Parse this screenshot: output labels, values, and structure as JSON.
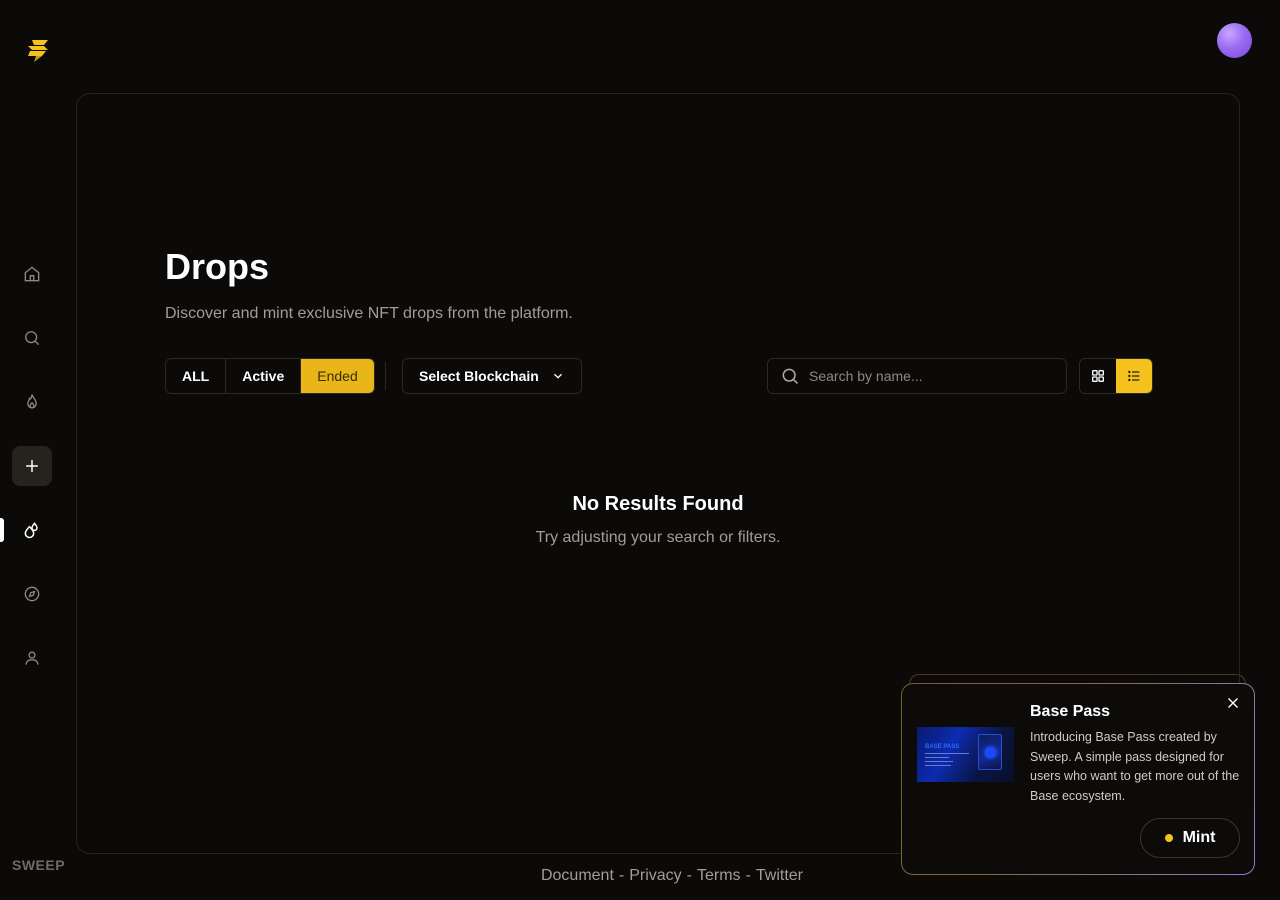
{
  "brand": {
    "name": "SWEEP",
    "logo_icon": "sweep-logo-icon"
  },
  "sidebar": {
    "items": [
      {
        "name": "home",
        "icon": "home-icon"
      },
      {
        "name": "search",
        "icon": "search-icon"
      },
      {
        "name": "trending",
        "icon": "flame-icon"
      },
      {
        "name": "create",
        "icon": "plus-icon"
      },
      {
        "name": "drops",
        "icon": "drops-icon",
        "active": true
      },
      {
        "name": "explore",
        "icon": "compass-icon"
      },
      {
        "name": "profile",
        "icon": "user-icon"
      }
    ]
  },
  "page": {
    "title": "Drops",
    "subtitle": "Discover and mint exclusive NFT drops from the platform."
  },
  "filters": {
    "tabs": [
      {
        "label": "ALL"
      },
      {
        "label": "Active"
      },
      {
        "label": "Ended",
        "active": true
      }
    ],
    "blockchain_select": "Select Blockchain",
    "search_placeholder": "Search by name...",
    "view_mode": "list"
  },
  "empty_state": {
    "title": "No Results Found",
    "message": "Try adjusting your search or filters."
  },
  "footer": {
    "links": [
      "Document",
      "Privacy",
      "Terms",
      "Twitter"
    ],
    "separator": "-"
  },
  "promo": {
    "title": "Base Pass",
    "description": "Introducing Base Pass created by Sweep. A simple pass designed for users who want to get more out of the Base ecosystem.",
    "button_label": "Mint",
    "image_caption": "BASE PASS"
  },
  "colors": {
    "accent": "#f3c21c",
    "background": "#0b0a09",
    "muted_text": "#a19d97"
  }
}
